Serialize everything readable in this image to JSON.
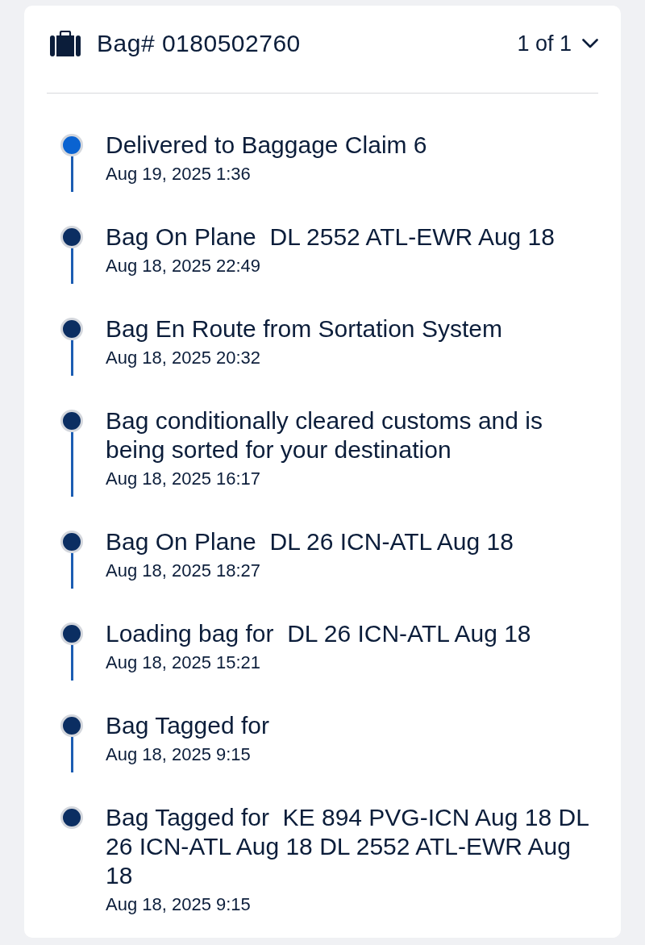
{
  "bag": {
    "title": "Bag# 0180502760",
    "pager": "1 of 1"
  },
  "events": [
    {
      "status": "Delivered to Baggage Claim 6",
      "time": "Aug 19, 2025 1:36",
      "current": true
    },
    {
      "status": "Bag On Plane  DL 2552 ATL-EWR Aug 18",
      "time": "Aug 18, 2025 22:49",
      "current": false
    },
    {
      "status": "Bag En Route from Sortation System",
      "time": "Aug 18, 2025 20:32",
      "current": false
    },
    {
      "status": "Bag conditionally cleared customs and is being sorted for your destination",
      "time": "Aug 18, 2025 16:17",
      "current": false
    },
    {
      "status": "Bag On Plane  DL 26 ICN-ATL Aug 18",
      "time": "Aug 18, 2025 18:27",
      "current": false
    },
    {
      "status": "Loading bag for  DL 26 ICN-ATL Aug 18",
      "time": "Aug 18, 2025 15:21",
      "current": false
    },
    {
      "status": "Bag Tagged for",
      "time": "Aug 18, 2025 9:15",
      "current": false
    },
    {
      "status": "Bag Tagged for  KE 894 PVG-ICN Aug 18 DL 26 ICN-ATL Aug 18 DL 2552 ATL-EWR Aug 18",
      "time": "Aug 18, 2025 9:15",
      "current": false
    }
  ]
}
